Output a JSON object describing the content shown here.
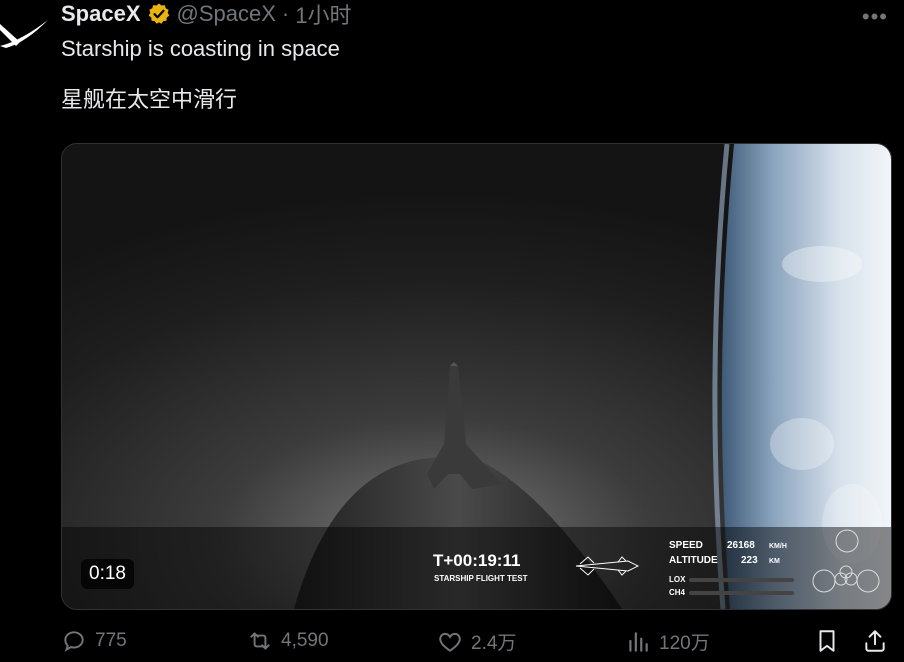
{
  "account": {
    "name": "SpaceX",
    "handle": "@SpaceX",
    "separator": "·",
    "time": "1小时"
  },
  "more_label": "•••",
  "tweet": {
    "line1": "Starship is coasting in space",
    "line2": "星舰在太空中滑行"
  },
  "video": {
    "duration": "0:18",
    "timer": "T+00:19:11",
    "flight_label": "STARSHIP FLIGHT TEST",
    "speed_label": "SPEED",
    "speed_value": "26168",
    "speed_unit": "KM/H",
    "altitude_label": "ALTITUDE",
    "altitude_value": "223",
    "altitude_unit": "KM",
    "lox_label": "LOX",
    "ch4_label": "CH4"
  },
  "actions": {
    "replies": "775",
    "reposts": "4,590",
    "likes": "2.4万",
    "views": "120万"
  },
  "colors": {
    "verified": "#e9b310",
    "muted": "#71767b",
    "text": "#e7e9ea"
  }
}
